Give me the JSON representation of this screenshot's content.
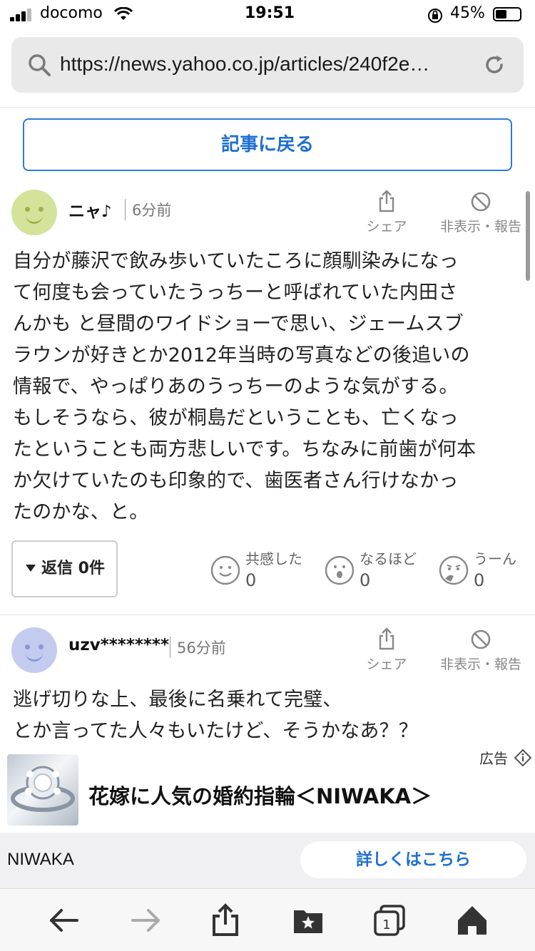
{
  "status_bar": {
    "carrier": "docomo",
    "time": "19:51",
    "battery": "45%"
  },
  "url_bar": {
    "url": "https://news.yahoo.co.jp/articles/240f2e…"
  },
  "back_button": "記事に戻る",
  "comments": [
    {
      "username": "ニャ♪",
      "time": "6分前",
      "share_label": "シェア",
      "hide_label": "非表示・報告",
      "avatar_color": "#d4e39a",
      "lines": [
        "自分が藤沢で飲み歩いていたころに顔馴染みになっ",
        "て何度も会っていたうっちーと呼ばれていた内田さ",
        "んかも と昼間のワイドショーで思い、ジェームスブ",
        "ラウンが好きとか2012年当時の写真などの後追いの",
        "情報で、やっぱりあのうっちーのような気がする。",
        "もしそうなら、彼が桐島だということも、亡くなっ",
        "たということも両方悲しいです。ちなみに前歯が何本",
        "か欠けていたのも印象的で、歯医者さん行けなかっ",
        "たのかな、と。"
      ],
      "reply_label": "返信 0件",
      "reactions": [
        {
          "label": "共感した",
          "count": "0"
        },
        {
          "label": "なるほど",
          "count": "0"
        },
        {
          "label": "うーん",
          "count": "0"
        }
      ]
    },
    {
      "username": "uzv********",
      "time": "56分前",
      "share_label": "シェア",
      "hide_label": "非表示・報告",
      "avatar_color": "#c3cbee",
      "lines": [
        "逃げ切りな上、最後に名乗れて完璧、",
        "とか言ってた人々もいたけど、そうかなあ？？"
      ]
    }
  ],
  "ad": {
    "label": "広告",
    "title": "花嫁に人気の婚約指輪＜NIWAKA＞",
    "brand": "NIWAKA",
    "cta": "詳しくはこちら"
  },
  "colors": {
    "accent": "#1f6fd1"
  }
}
